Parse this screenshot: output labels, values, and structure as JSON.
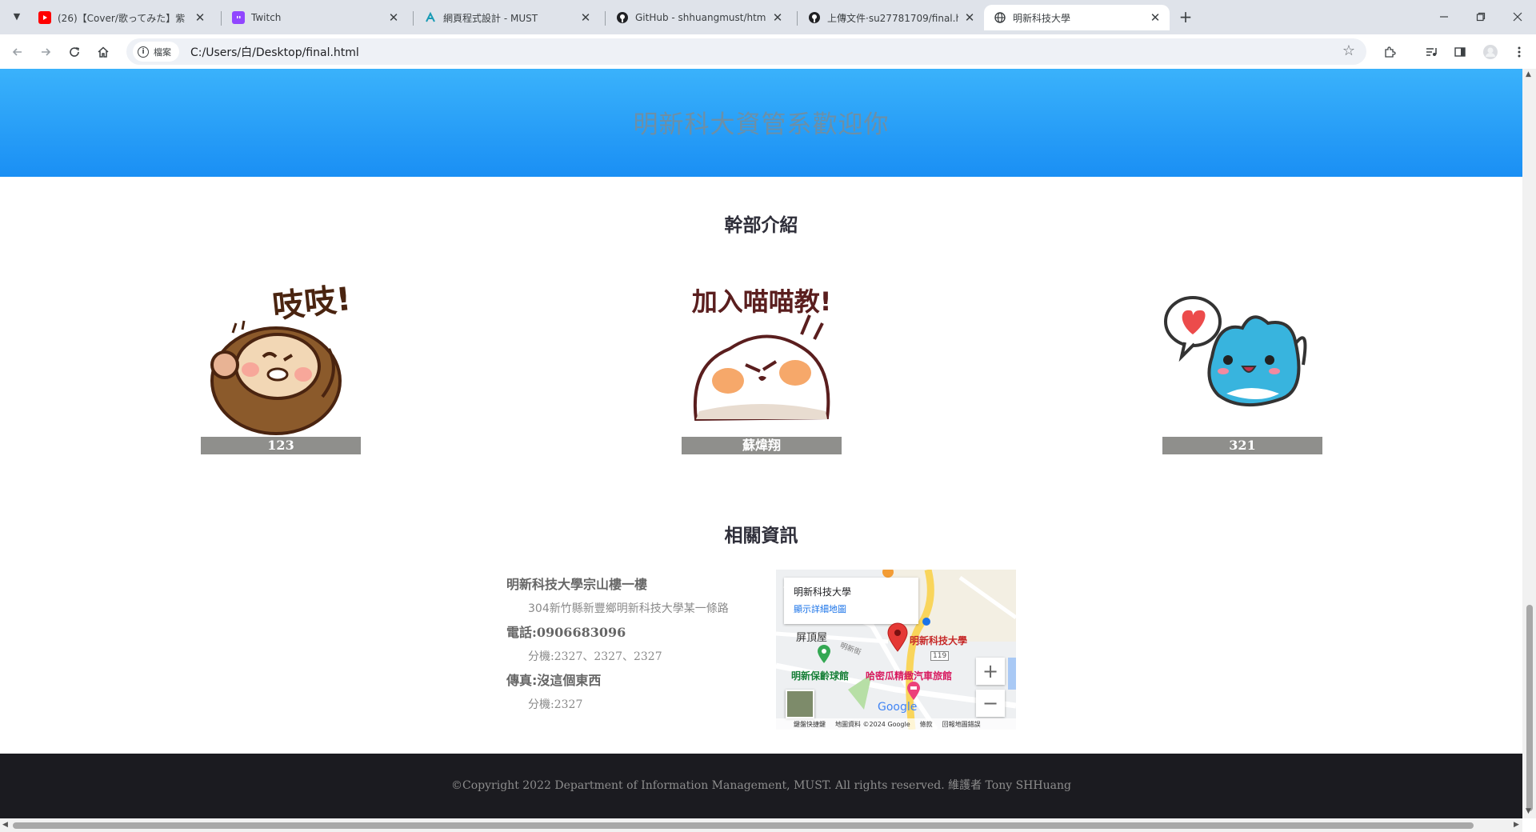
{
  "browser": {
    "tabs": [
      {
        "title": "(26)【Cover/歌ってみた】紫",
        "favicon": "youtube-icon",
        "color": "#ff0000"
      },
      {
        "title": "Twitch",
        "favicon": "twitch-icon",
        "color": "#9146ff"
      },
      {
        "title": "網頁程式設計 - MUST",
        "favicon": "edu-icon",
        "color": "#1a9bb5"
      },
      {
        "title": "GitHub - shhuangmust/html",
        "favicon": "github-icon",
        "color": "#202124"
      },
      {
        "title": "上傳文件·su27781709/final.htm",
        "favicon": "github-icon",
        "color": "#202124"
      },
      {
        "title": "明新科技大學",
        "favicon": "globe-icon",
        "color": "#3c4043",
        "active": true
      }
    ],
    "address_chip": "檔案",
    "url": "C:/Users/白/Desktop/final.html"
  },
  "page": {
    "banner_title": "明新科大資管系歡迎你",
    "members_heading": "幹部介紹",
    "members": [
      {
        "name": "123",
        "sticker_text": "吱吱!",
        "sticker": "monkey-sticker"
      },
      {
        "name": "蘇煒翔",
        "sticker_text": "加入喵喵教!",
        "sticker": "bird-sticker"
      },
      {
        "name": "321",
        "sticker_text": "",
        "sticker": "blue-cat-heart-sticker"
      }
    ],
    "info_heading": "相關資訊",
    "info": {
      "place": "明新科技大學宗山樓一樓",
      "address": "304新竹縣新豐鄉明新科技大學某一條路",
      "phone": "電話:0906683096",
      "phone_ext": "分機:2327、2327、2327",
      "fax": "傳真:沒這個東西",
      "fax_ext": "分機:2327"
    },
    "map": {
      "card_title": "明新科技大學",
      "card_link": "顯示詳細地圖",
      "marker_label": "明新科技大學",
      "labels": [
        "屏頂屋",
        "明新保齡球館",
        "哈密瓜精緻汽車旅館",
        "明新街"
      ],
      "road_number": "119",
      "logo": "Google",
      "footer": [
        "鍵盤快捷鍵",
        "地圖資料 ©2024 Google",
        "條款",
        "回報地圖錯誤"
      ],
      "zoom_in": "+",
      "zoom_out": "−"
    },
    "footer_text": "©Copyright 2022 Department of Information Management, MUST. All rights reserved. 維護者 Tony SHHuang"
  }
}
